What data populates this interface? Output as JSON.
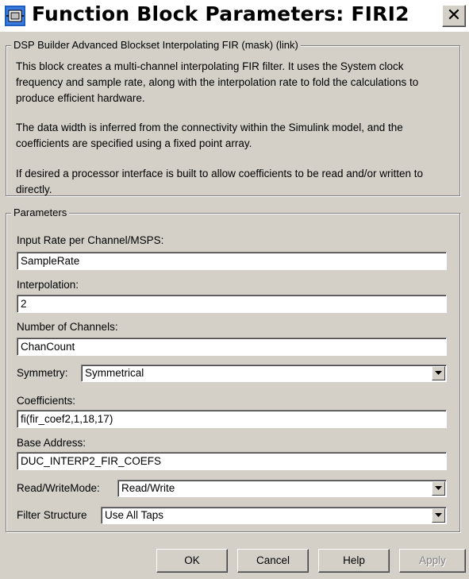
{
  "window": {
    "title": "Function Block Parameters: FIRI2",
    "close_glyph": "✕"
  },
  "description_group": {
    "title": "DSP Builder Advanced Blockset Interpolating FIR (mask) (link)",
    "paragraphs": [
      "This block creates a multi-channel interpolating FIR filter. It uses the System clock frequency and sample rate, along with the interpolation rate to fold the calculations to produce efficient hardware.",
      "The data width is inferred from the connectivity within the Simulink model, and the coefficients are specified using a fixed point array.",
      "If desired a processor interface is built to allow coefficients to be read and/or written to directly."
    ]
  },
  "parameters_group": {
    "title": "Parameters",
    "input_rate": {
      "label": "Input Rate per Channel/MSPS:",
      "value": "SampleRate"
    },
    "interpolation": {
      "label": "Interpolation:",
      "value": "2"
    },
    "channels": {
      "label": "Number of Channels:",
      "value": "ChanCount"
    },
    "symmetry": {
      "label": "Symmetry:",
      "value": "Symmetrical"
    },
    "coefficients": {
      "label": "Coefficients:",
      "value": "fi(fir_coef2,1,18,17)"
    },
    "base_address": {
      "label": "Base Address:",
      "value": "DUC_INTERP2_FIR_COEFS"
    },
    "rw_mode": {
      "label": "Read/WriteMode:",
      "value": "Read/Write"
    },
    "filter_structure": {
      "label": "Filter Structure",
      "value": "Use All Taps"
    }
  },
  "buttons": {
    "ok": "OK",
    "cancel": "Cancel",
    "help": "Help",
    "apply": "Apply"
  },
  "icons": {
    "title_icon": "simulink-block-icon",
    "dropdown_icon": "chevron-down-icon"
  },
  "colors": {
    "dialog_bg": "#d4d0c8",
    "title_bg": "#ffffff",
    "disabled_text": "#808080"
  }
}
